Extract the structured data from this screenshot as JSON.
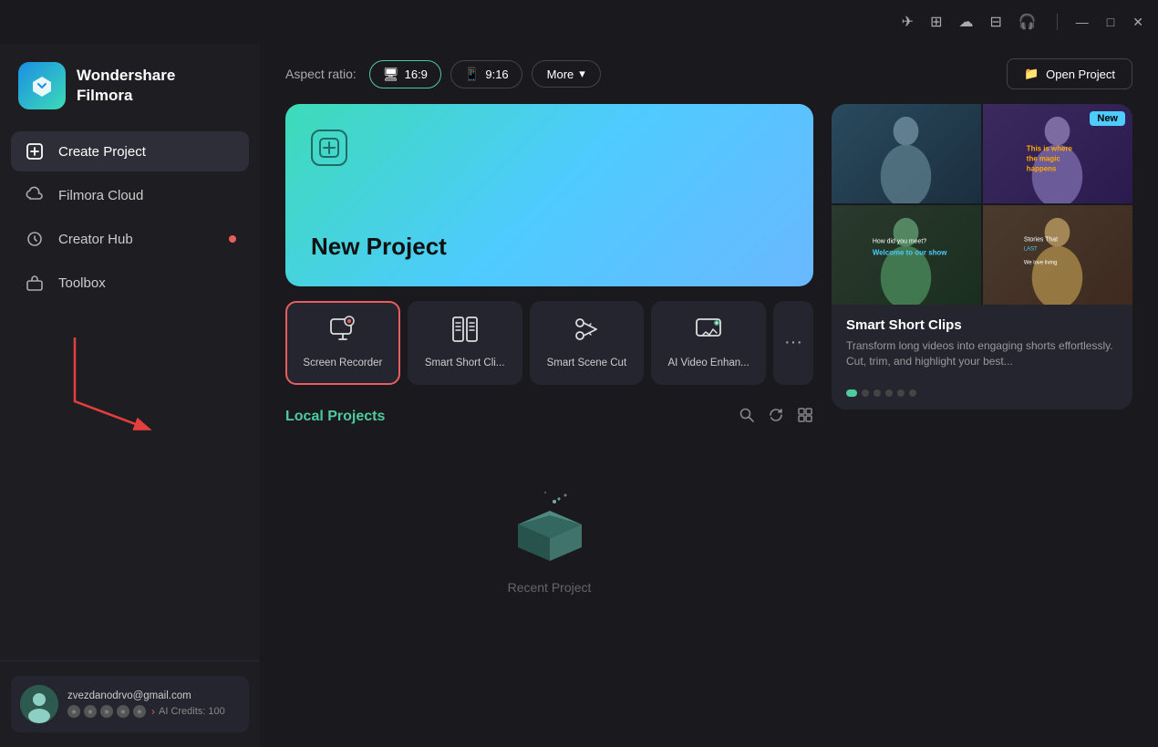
{
  "app": {
    "name": "Wondershare",
    "name2": "Filmora"
  },
  "titlebar": {
    "icons": [
      "✈",
      "⊞",
      "☁",
      "⊟",
      "🎧"
    ],
    "min": "—",
    "max": "□",
    "close": "✕"
  },
  "sidebar": {
    "nav_items": [
      {
        "id": "create",
        "label": "Create Project",
        "active": true
      },
      {
        "id": "cloud",
        "label": "Filmora Cloud",
        "active": false
      },
      {
        "id": "hub",
        "label": "Creator Hub",
        "active": false,
        "dot": true
      },
      {
        "id": "toolbox",
        "label": "Toolbox",
        "active": false
      }
    ]
  },
  "user": {
    "email": "zvezdanodrvo@gmail.com",
    "credits_label": "AI Credits: 100"
  },
  "topbar": {
    "aspect_label": "Aspect ratio:",
    "aspect_16_9": "16:9",
    "aspect_9_16": "9:16",
    "more": "More",
    "open_project": "Open Project"
  },
  "new_project": {
    "title": "New Project"
  },
  "tools": [
    {
      "id": "screen-recorder",
      "label": "Screen Recorder",
      "selected": true
    },
    {
      "id": "smart-short-clips",
      "label": "Smart Short Cli..."
    },
    {
      "id": "smart-scene-cut",
      "label": "Smart Scene Cut"
    },
    {
      "id": "ai-video-enhance",
      "label": "AI Video Enhan..."
    }
  ],
  "local_projects": {
    "title": "Local Projects",
    "empty_text": "Recent Project"
  },
  "promo": {
    "badge": "New",
    "title": "Smart Short Clips",
    "description": "Transform long videos into engaging shorts effortlessly. Cut, trim, and highlight your best...",
    "dots": [
      true,
      false,
      false,
      false,
      false,
      false
    ]
  }
}
